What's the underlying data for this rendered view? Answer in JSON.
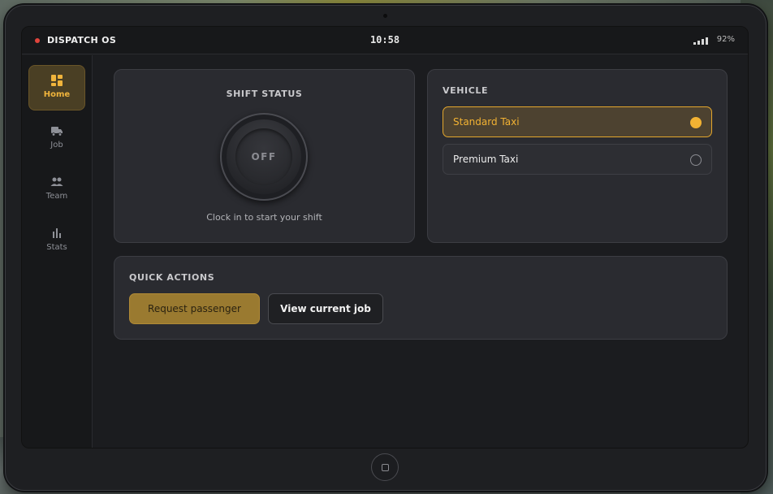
{
  "statusbar": {
    "brand": "DISPATCH OS",
    "clock": "10:58",
    "battery": "92%",
    "signal_icon": "signal-bars-icon",
    "recording_color": "#e0443c"
  },
  "sidebar": {
    "items": [
      {
        "label": "Home",
        "icon": "grid-icon",
        "active": true
      },
      {
        "label": "Job",
        "icon": "truck-icon",
        "active": false
      },
      {
        "label": "Team",
        "icon": "people-icon",
        "active": false
      },
      {
        "label": "Stats",
        "icon": "bar-chart-icon",
        "active": false
      }
    ]
  },
  "shift": {
    "title": "SHIFT STATUS",
    "state": "OFF",
    "hint": "Clock in to start your shift"
  },
  "vehicle": {
    "title": "VEHICLE",
    "options": [
      {
        "label": "Standard Taxi",
        "selected": true
      },
      {
        "label": "Premium Taxi",
        "selected": false
      }
    ]
  },
  "quick_actions": {
    "title": "QUICK ACTIONS",
    "primary_label": "Request passenger",
    "secondary_label": "View current job"
  },
  "theme": {
    "accent": "#f2b233",
    "card_bg": "#2a2b30",
    "screen_bg": "#1b1c1f"
  }
}
